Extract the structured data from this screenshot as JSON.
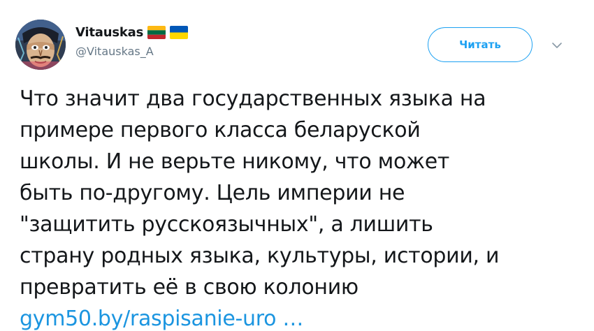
{
  "user": {
    "display_name": "Vitauskas",
    "handle": "@Vitauskas_A",
    "flags": [
      "lithuania-flag",
      "ukraine-flag"
    ]
  },
  "actions": {
    "follow_label": "Читать",
    "menu_icon": "chevron-down-icon"
  },
  "tweet": {
    "lines": [
      "Что значит два государственных языка на",
      "примере первого класса беларуской",
      "школы. И не верьте никому, что может",
      "быть по-другому. Цель империи не",
      "\"защитить русскоязычных\", а лишить",
      "страну родных языка, культуры, истории, и",
      "превратить её в свою колонию"
    ],
    "link_text": "gym50.by/raspisanie-uro …"
  },
  "colors": {
    "accent": "#1da1f2",
    "link": "#1b95e0",
    "text": "#14171a",
    "secondary": "#657786"
  }
}
